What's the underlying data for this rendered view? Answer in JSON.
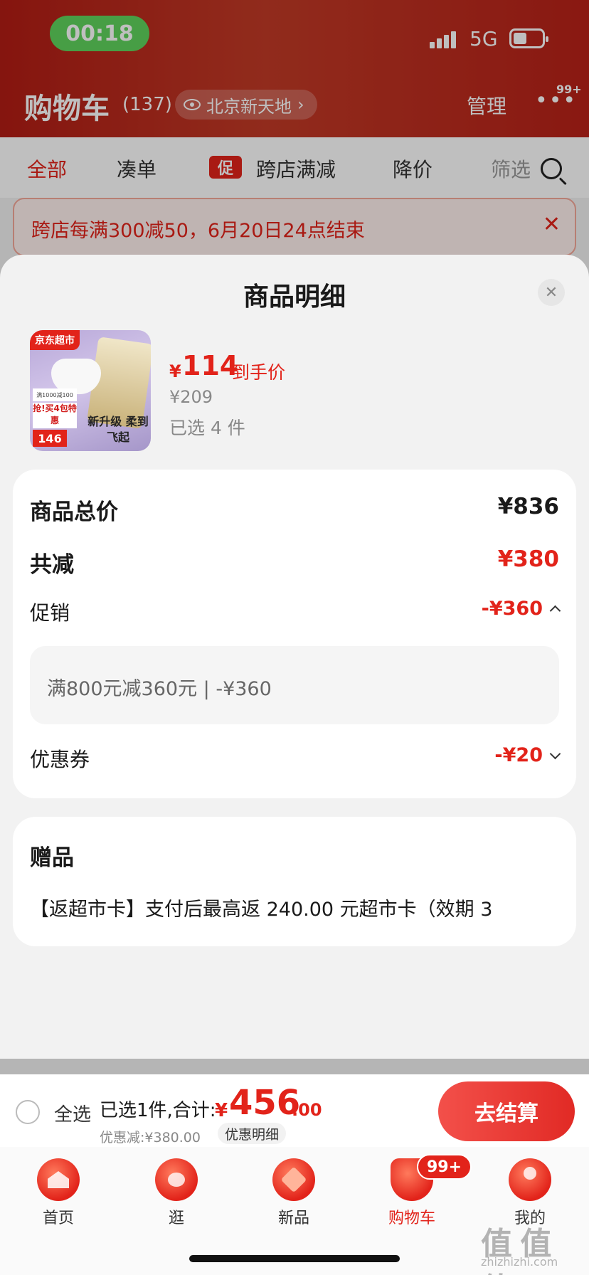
{
  "status_bar": {
    "time": "00:18",
    "network": "5G"
  },
  "header": {
    "title": "购物车",
    "count": "(137)",
    "location": "北京新天地",
    "location_chevron": "›",
    "manage": "管理",
    "more": "•••",
    "more_badge": "99+"
  },
  "filters": {
    "all": "全部",
    "bundle": "凑单",
    "promo_tag": "促",
    "cross_store": "跨店满减",
    "price_drop": "降价",
    "filter": "筛选"
  },
  "banner": {
    "text": "跨店每满300减50，6月20日24点结束",
    "close": "✕"
  },
  "sheet": {
    "title": "商品明细",
    "close": "✕",
    "product": {
      "image_brand": "京东超市",
      "image_tag_1": "满1000减100",
      "image_tag_2": "抢!买4包特惠",
      "image_price": "146",
      "image_slogan": "新升级 柔到飞起",
      "currency": "¥",
      "price": "114",
      "price_label": "到手价",
      "original_price": "¥209",
      "selected_qty": "已选 4 件"
    },
    "price_card": {
      "total_label": "商品总价",
      "total_value": "¥836",
      "discount_label": "共减",
      "discount_value": "¥380",
      "promo_label": "促销",
      "promo_value": "-¥360",
      "promo_detail": "满800元减360元 | -¥360",
      "coupon_label": "优惠券",
      "coupon_value": "-¥20"
    },
    "gift_card": {
      "title": "赠品",
      "text": "【返超市卡】支付后最高返 240.00 元超市卡（效期 3"
    }
  },
  "checkout": {
    "select_all": "全选",
    "summary_label": "已选1件,合计:",
    "currency": "¥",
    "total_int": "456",
    "total_dec": ".00",
    "discount_text": "优惠减:¥380.00",
    "detail_link": "优惠明细",
    "button": "去结算"
  },
  "tabbar": {
    "items": [
      {
        "label": "首页",
        "icon": "home-icon"
      },
      {
        "label": "逛",
        "icon": "browse-icon"
      },
      {
        "label": "新品",
        "icon": "new-products-icon"
      },
      {
        "label": "购物车",
        "icon": "cart-icon"
      },
      {
        "label": "我的",
        "icon": "profile-icon"
      }
    ],
    "cart_badge": "99+",
    "active_index": 3
  },
  "watermark": {
    "main": "值 值 值",
    "sub": "zhizhizhi.com"
  },
  "colors": {
    "accent": "#e2231a",
    "sheet_bg": "#f2f2f2",
    "card_bg": "#ffffff"
  }
}
